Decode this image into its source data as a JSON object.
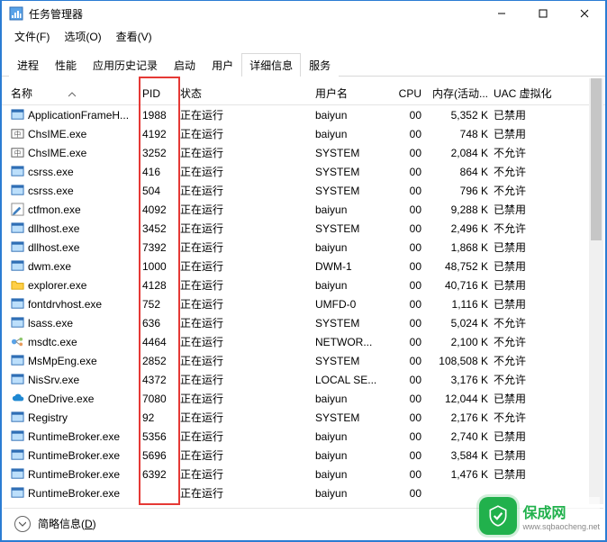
{
  "window": {
    "title": "任务管理器"
  },
  "menu": {
    "file": "文件(F)",
    "options": "选项(O)",
    "view": "查看(V)"
  },
  "tabs": [
    {
      "label": "进程"
    },
    {
      "label": "性能"
    },
    {
      "label": "应用历史记录"
    },
    {
      "label": "启动"
    },
    {
      "label": "用户"
    },
    {
      "label": "详细信息"
    },
    {
      "label": "服务"
    }
  ],
  "columns": {
    "name": "名称",
    "pid": "PID",
    "state": "状态",
    "user": "用户名",
    "cpu": "CPU",
    "mem": "内存(活动...",
    "uac": "UAC 虚拟化"
  },
  "footer": {
    "label_pre": "简略信息(",
    "label_u": "D",
    "label_post": ")"
  },
  "watermark": {
    "text": "保成网",
    "site": "www.sqbaocheng.net"
  },
  "rows": [
    {
      "icon": "window",
      "name": "ApplicationFrameH...",
      "pid": "1988",
      "state": "正在运行",
      "user": "baiyun",
      "cpu": "00",
      "mem": "5,352 K",
      "uac": "已禁用"
    },
    {
      "icon": "ime",
      "name": "ChsIME.exe",
      "pid": "4192",
      "state": "正在运行",
      "user": "baiyun",
      "cpu": "00",
      "mem": "748 K",
      "uac": "已禁用"
    },
    {
      "icon": "ime",
      "name": "ChsIME.exe",
      "pid": "3252",
      "state": "正在运行",
      "user": "SYSTEM",
      "cpu": "00",
      "mem": "2,084 K",
      "uac": "不允许"
    },
    {
      "icon": "window",
      "name": "csrss.exe",
      "pid": "416",
      "state": "正在运行",
      "user": "SYSTEM",
      "cpu": "00",
      "mem": "864 K",
      "uac": "不允许"
    },
    {
      "icon": "window",
      "name": "csrss.exe",
      "pid": "504",
      "state": "正在运行",
      "user": "SYSTEM",
      "cpu": "00",
      "mem": "796 K",
      "uac": "不允许"
    },
    {
      "icon": "pen",
      "name": "ctfmon.exe",
      "pid": "4092",
      "state": "正在运行",
      "user": "baiyun",
      "cpu": "00",
      "mem": "9,288 K",
      "uac": "已禁用"
    },
    {
      "icon": "window",
      "name": "dllhost.exe",
      "pid": "3452",
      "state": "正在运行",
      "user": "SYSTEM",
      "cpu": "00",
      "mem": "2,496 K",
      "uac": "不允许"
    },
    {
      "icon": "window",
      "name": "dllhost.exe",
      "pid": "7392",
      "state": "正在运行",
      "user": "baiyun",
      "cpu": "00",
      "mem": "1,868 K",
      "uac": "已禁用"
    },
    {
      "icon": "window",
      "name": "dwm.exe",
      "pid": "1000",
      "state": "正在运行",
      "user": "DWM-1",
      "cpu": "00",
      "mem": "48,752 K",
      "uac": "已禁用"
    },
    {
      "icon": "folder",
      "name": "explorer.exe",
      "pid": "4128",
      "state": "正在运行",
      "user": "baiyun",
      "cpu": "00",
      "mem": "40,716 K",
      "uac": "已禁用"
    },
    {
      "icon": "window",
      "name": "fontdrvhost.exe",
      "pid": "752",
      "state": "正在运行",
      "user": "UMFD-0",
      "cpu": "00",
      "mem": "1,116 K",
      "uac": "已禁用"
    },
    {
      "icon": "window",
      "name": "lsass.exe",
      "pid": "636",
      "state": "正在运行",
      "user": "SYSTEM",
      "cpu": "00",
      "mem": "5,024 K",
      "uac": "不允许"
    },
    {
      "icon": "msdtc",
      "name": "msdtc.exe",
      "pid": "4464",
      "state": "正在运行",
      "user": "NETWOR...",
      "cpu": "00",
      "mem": "2,100 K",
      "uac": "不允许"
    },
    {
      "icon": "window",
      "name": "MsMpEng.exe",
      "pid": "2852",
      "state": "正在运行",
      "user": "SYSTEM",
      "cpu": "00",
      "mem": "108,508 K",
      "uac": "不允许"
    },
    {
      "icon": "window",
      "name": "NisSrv.exe",
      "pid": "4372",
      "state": "正在运行",
      "user": "LOCAL SE...",
      "cpu": "00",
      "mem": "3,176 K",
      "uac": "不允许"
    },
    {
      "icon": "cloud",
      "name": "OneDrive.exe",
      "pid": "7080",
      "state": "正在运行",
      "user": "baiyun",
      "cpu": "00",
      "mem": "12,044 K",
      "uac": "已禁用"
    },
    {
      "icon": "window",
      "name": "Registry",
      "pid": "92",
      "state": "正在运行",
      "user": "SYSTEM",
      "cpu": "00",
      "mem": "2,176 K",
      "uac": "不允许"
    },
    {
      "icon": "window",
      "name": "RuntimeBroker.exe",
      "pid": "5356",
      "state": "正在运行",
      "user": "baiyun",
      "cpu": "00",
      "mem": "2,740 K",
      "uac": "已禁用"
    },
    {
      "icon": "window",
      "name": "RuntimeBroker.exe",
      "pid": "5696",
      "state": "正在运行",
      "user": "baiyun",
      "cpu": "00",
      "mem": "3,584 K",
      "uac": "已禁用"
    },
    {
      "icon": "window",
      "name": "RuntimeBroker.exe",
      "pid": "6392",
      "state": "正在运行",
      "user": "baiyun",
      "cpu": "00",
      "mem": "1,476 K",
      "uac": "已禁用"
    },
    {
      "icon": "window",
      "name": "RuntimeBroker.exe",
      "pid": "",
      "state": "正在运行",
      "user": "baiyun",
      "cpu": "00",
      "mem": "",
      "uac": ""
    }
  ]
}
